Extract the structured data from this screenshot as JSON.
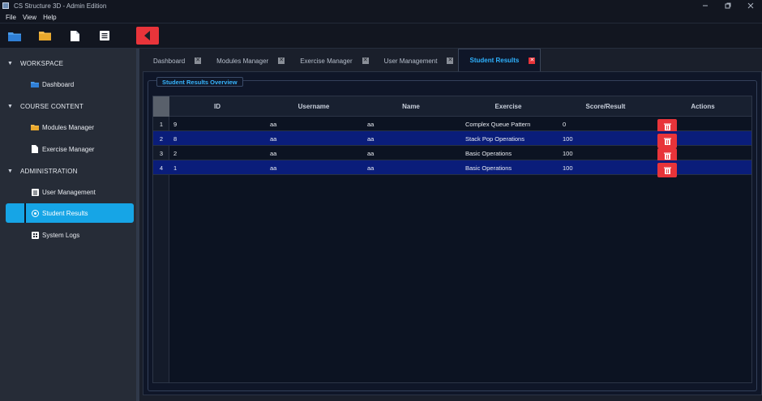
{
  "window": {
    "title": "CS Structure 3D - Admin Edition"
  },
  "menu": [
    "File",
    "View",
    "Help"
  ],
  "sidebar": {
    "sections": [
      {
        "label": "WORKSPACE",
        "items": [
          {
            "label": "Dashboard",
            "icon": "folder-blue-icon"
          }
        ]
      },
      {
        "label": "COURSE CONTENT",
        "items": [
          {
            "label": "Modules Manager",
            "icon": "folder-icon"
          },
          {
            "label": "Exercise Manager",
            "icon": "document-icon"
          }
        ]
      },
      {
        "label": "ADMINISTRATION",
        "items": [
          {
            "label": "User Management",
            "icon": "user-list-icon"
          },
          {
            "label": "Student Results",
            "icon": "results-icon",
            "active": true
          },
          {
            "label": "System Logs",
            "icon": "grid-icon"
          }
        ]
      }
    ]
  },
  "tabs": [
    {
      "label": "Dashboard"
    },
    {
      "label": "Modules Manager"
    },
    {
      "label": "Exercise Manager"
    },
    {
      "label": "User Management"
    },
    {
      "label": "Student Results",
      "active": true
    }
  ],
  "group": {
    "title": "Student Results Overview"
  },
  "table": {
    "columns": [
      "ID",
      "Username",
      "Name",
      "Exercise",
      "Score/Result",
      "Actions"
    ],
    "rows": [
      {
        "n": "1",
        "id": "9",
        "username": "aa",
        "name": "aa",
        "exercise": "Complex Queue Pattern",
        "score": "0",
        "selected": false
      },
      {
        "n": "2",
        "id": "8",
        "username": "aa",
        "name": "aa",
        "exercise": "Stack Pop Operations",
        "score": "100",
        "selected": true
      },
      {
        "n": "3",
        "id": "2",
        "username": "aa",
        "name": "aa",
        "exercise": "Basic Operations",
        "score": "100",
        "selected": false
      },
      {
        "n": "4",
        "id": "1",
        "username": "aa",
        "name": "aa",
        "exercise": "Basic Operations",
        "score": "100",
        "selected": true
      }
    ]
  },
  "colors": {
    "accent": "#16a5e6",
    "danger": "#e8343a",
    "selection": "#0a1d7a"
  }
}
